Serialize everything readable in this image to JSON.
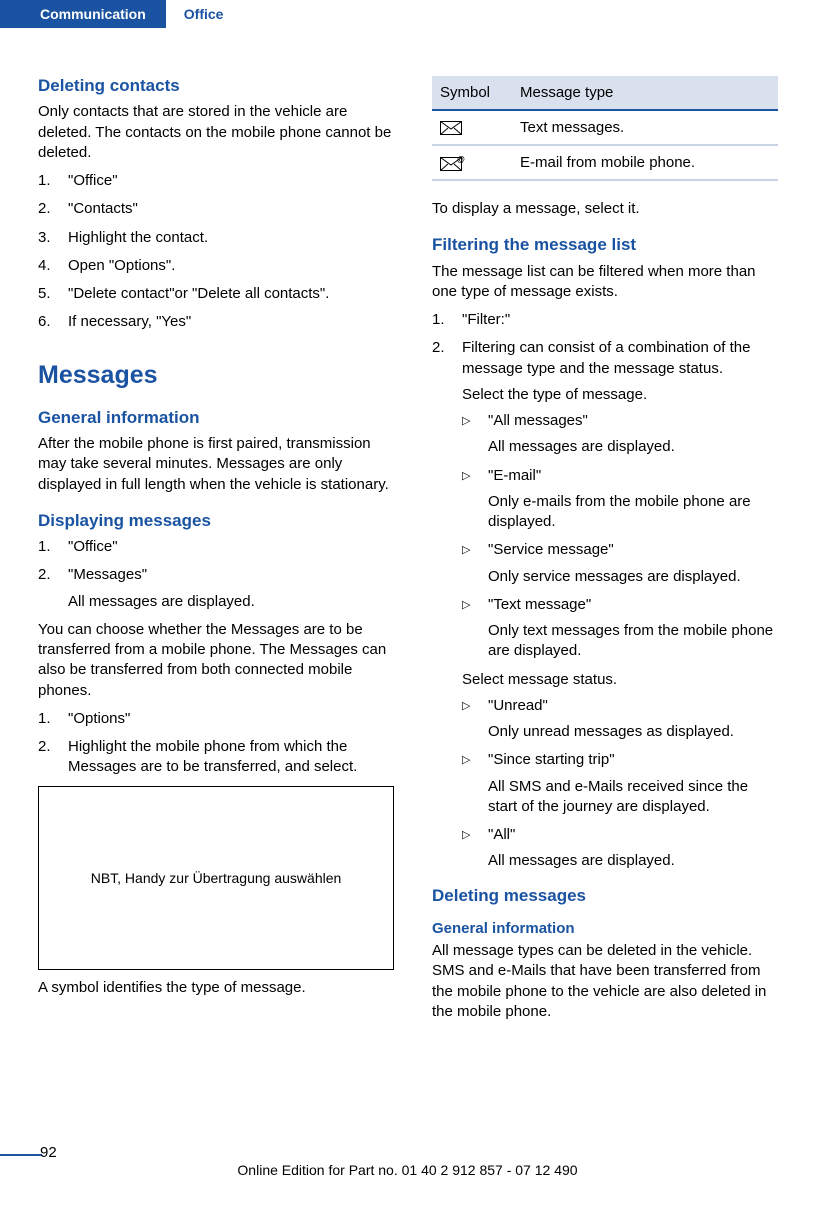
{
  "tabs": {
    "active": "Communication",
    "inactive": "Office"
  },
  "left": {
    "h_deleting": "Deleting contacts",
    "p_deleting": "Only contacts that are stored in the vehicle are deleted. The contacts on the mobile phone cannot be deleted.",
    "steps_deleting": [
      "\"Office\"",
      "\"Contacts\"",
      "Highlight the contact.",
      "Open \"Options\".",
      "\"Delete contact\"or \"Delete all contacts\".",
      "If necessary, \"Yes\""
    ],
    "h_messages": "Messages",
    "h_general": "General information",
    "p_general": "After the mobile phone is first paired, transmission may take several minutes. Messages are only displayed in full length when the vehicle is stationary.",
    "h_displaying": "Displaying messages",
    "steps_display": [
      "\"Office\"",
      "\"Messages\""
    ],
    "sub_display": "All messages are displayed.",
    "p_choose": "You can choose whether the Messages are to be transferred from a mobile phone. The Messages can also be transferred from both connected mobile phones.",
    "steps_options": [
      "\"Options\"",
      "Highlight the mobile phone from which the Messages are to be transferred, and select."
    ],
    "image_caption": "NBT, Handy zur Übertragung auswählen",
    "p_symbol": "A symbol identifies the type of message."
  },
  "right": {
    "table": {
      "h1": "Symbol",
      "h2": "Message type",
      "r1": "Text messages.",
      "r2": "E-mail from mobile phone."
    },
    "p_todisplay": "To display a message, select it.",
    "h_filtering": "Filtering the message list",
    "p_filtering": "The message list can be filtered when more than one type of message exists.",
    "steps_filter": [
      "\"Filter:\"",
      "Filtering can consist of a combination of the message type and the message status."
    ],
    "p_selecttype": "Select the type of message.",
    "type_items": [
      {
        "t": "\"All messages\"",
        "d": "All messages are displayed."
      },
      {
        "t": "\"E-mail\"",
        "d": "Only e-mails from the mobile phone are displayed."
      },
      {
        "t": "\"Service message\"",
        "d": "Only service messages are displayed."
      },
      {
        "t": "\"Text message\"",
        "d": "Only text messages from the mobile phone are displayed."
      }
    ],
    "p_selectstatus": "Select message status.",
    "status_items": [
      {
        "t": "\"Unread\"",
        "d": "Only unread messages as displayed."
      },
      {
        "t": "\"Since starting trip\"",
        "d": "All SMS and e-Mails received since the start of the journey are displayed."
      },
      {
        "t": "\"All\"",
        "d": "All messages are displayed."
      }
    ],
    "h_deleting_msg": "Deleting messages",
    "h_general2": "General information",
    "p_general2": "All message types can be deleted in the vehicle. SMS and e-Mails that have been transferred from the mobile phone to the vehicle are also deleted in the mobile phone."
  },
  "footer": {
    "page": "92",
    "text": "Online Edition for Part no. 01 40 2 912 857 - 07 12 490"
  }
}
